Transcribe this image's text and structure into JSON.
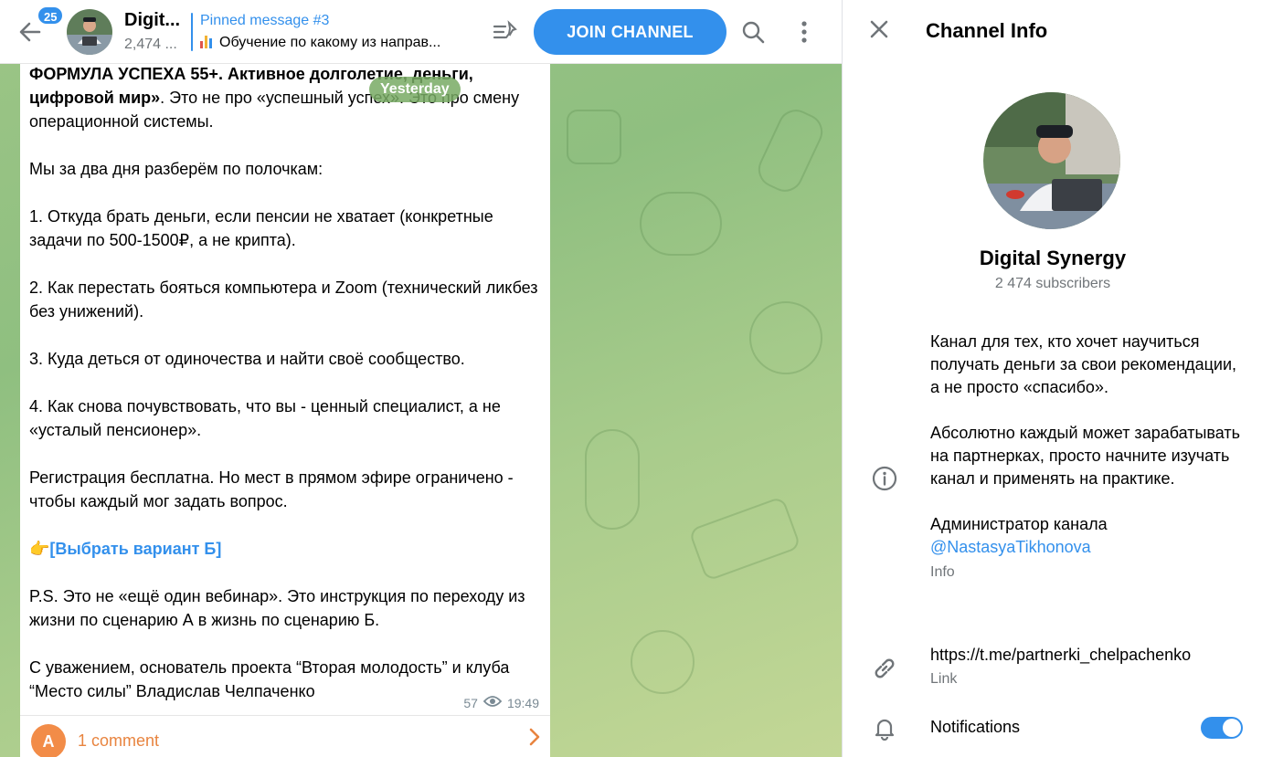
{
  "header": {
    "unread_count": "25",
    "channel_title": "Digit...",
    "subscribers_short": "2,474 ...",
    "pinned_title": "Pinned message #3",
    "pinned_text": "Обучение по какому из направ...",
    "join_label": "JOIN CHANNEL"
  },
  "message": {
    "date_pill": "Yesterday",
    "heading_bold": "ФОРМУЛА УСПЕХА 55+. Активное долголетие, деньги, цифровой мир»",
    "heading_rest": ". Это не про «успешный успех». Это про смену операционной системы.",
    "p1": "Мы за два дня разберём по полочкам:",
    "p2": "1. Откуда брать деньги, если пенсии не хватает (конкретные задачи по 500-1500₽, а не крипта).",
    "p3": "2. Как перестать бояться компьютера и Zoom (технический ликбез без унижений).",
    "p4": "3. Куда деться от одиночества и найти своё сообщество.",
    "p5": "4. Как снова почувствовать, что вы -  ценный специалист, а не «усталый пенсионер».",
    "p6": "Регистрация бесплатна. Но мест в прямом эфире ограничено - чтобы каждый мог задать вопрос.",
    "link_emoji": "👉",
    "link_text": "[Выбрать вариант Б]",
    "p7": "P.S. Это не «ещё один вебинар». Это инструкция по переходу из жизни по сценарию А в жизнь по сценарию Б.",
    "p8": "С уважением, основатель проекта “Вторая молодость” и клуба “Место силы” Владислав Челпаченко",
    "views": "57",
    "time": "19:49"
  },
  "comments": {
    "avatar_letter": "A",
    "label": "1 comment"
  },
  "info": {
    "title": "Channel Info",
    "name": "Digital Synergy",
    "subscribers": "2 474 subscribers",
    "desc_p1": "Канал для тех, кто хочет научиться получать деньги за свои рекомендации, а не просто «спасибо».",
    "desc_p2": "Абсолютно каждый может зарабатывать на партнерках, просто начните изучать канал и применять на практике.",
    "desc_p3": "Администратор канала",
    "admin_mention": "@NastasyaTikhonova",
    "info_label": "Info",
    "link": "https://t.me/partnerki_chelpachenko",
    "link_label": "Link",
    "notifications_label": "Notifications",
    "notifications_on": true
  },
  "colors": {
    "accent": "#3390ec",
    "comment_orange": "#e8843f"
  }
}
